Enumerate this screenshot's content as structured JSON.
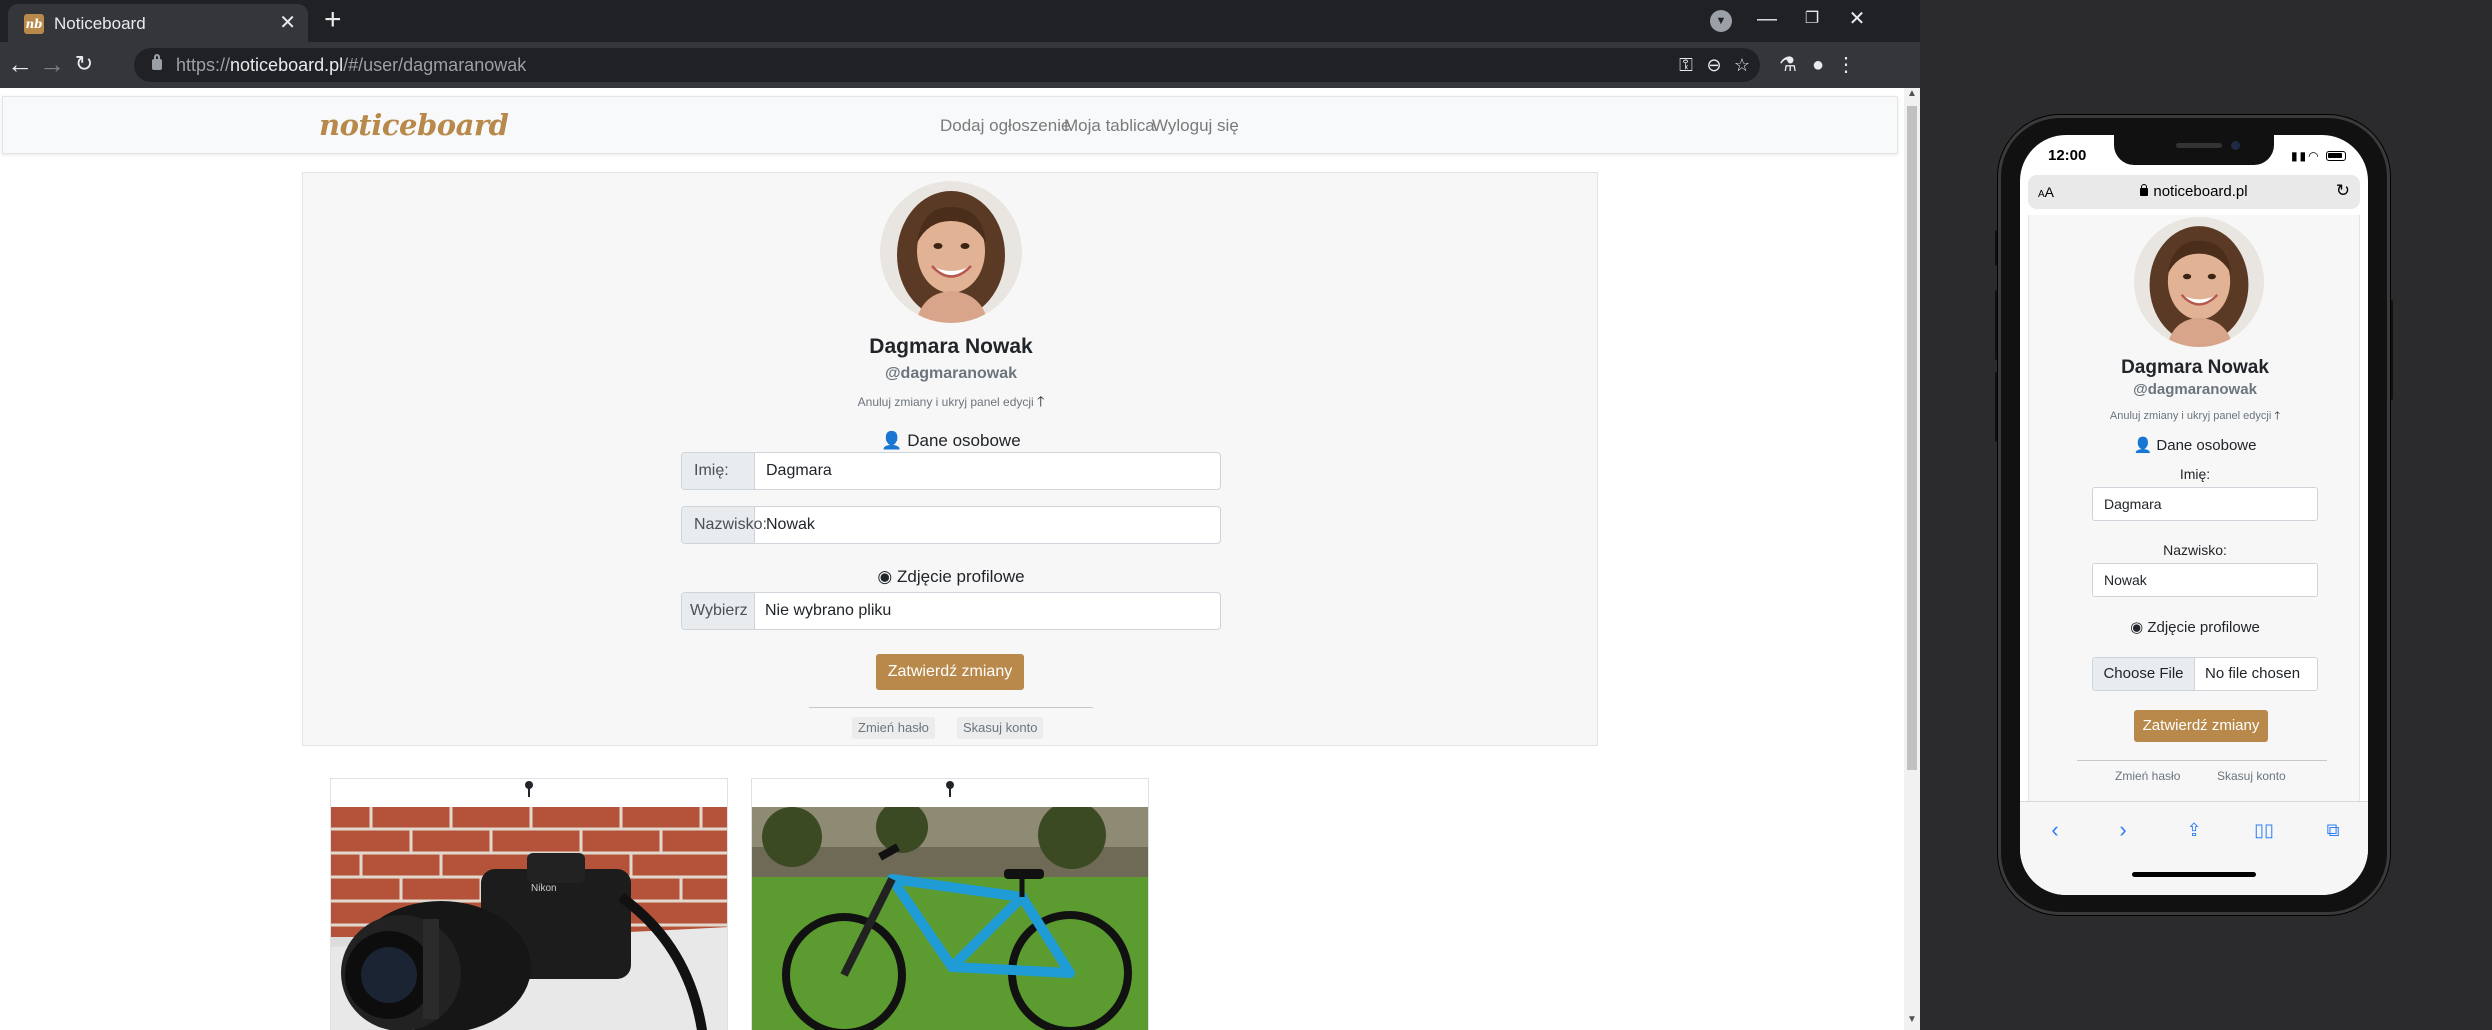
{
  "browser": {
    "tab_title": "Noticeboard",
    "tab_favicon": "nb",
    "url_scheme": "https://",
    "url_host": "noticeboard.pl",
    "url_path": "/#/user/dagmaranowak",
    "icons": [
      "back-icon",
      "forward-icon",
      "reload-icon",
      "key-icon",
      "zoom-icon",
      "star-icon",
      "labs-icon",
      "profile-icon",
      "menu-icon"
    ]
  },
  "site": {
    "brand": "noticeboard",
    "brand_color": "#b8894a",
    "nav": [
      "Dodaj ogłoszenie",
      "Moja tablica",
      "Wyloguj się"
    ]
  },
  "profile": {
    "name": "Dagmara Nowak",
    "username": "@dagmaranowak",
    "cancel_edit": "Anuluj zmiany i ukryj panel edycji",
    "personal_heading": "Dane osobowe",
    "first_name_label": "Imię:",
    "first_name_value": "Dagmara",
    "last_name_label": "Nazwisko:",
    "last_name_value": "Nowak",
    "photo_heading": "Zdjęcie profilowe",
    "file_button": "Wybierz plik",
    "file_status": "Nie wybrano pliku",
    "save_button": "Zatwierdź zmiany",
    "change_password": "Zmień hasło",
    "delete_account": "Skasuj konto"
  },
  "listings": [
    {
      "image": "camera-photo"
    },
    {
      "image": "bicycle-photo"
    }
  ],
  "mobile": {
    "time": "12:00",
    "aa": "AA",
    "host": "noticeboard.pl",
    "name": "Dagmara Nowak",
    "username": "@dagmaranowak",
    "cancel_edit": "Anuluj zmiany i ukryj panel edycji",
    "personal_heading": "Dane osobowe",
    "first_name_label": "Imię:",
    "first_name_value": "Dagmara",
    "last_name_label": "Nazwisko:",
    "last_name_value": "Nowak",
    "photo_heading": "Zdjęcie profilowe",
    "file_button": "Choose File",
    "file_status": "No file chosen",
    "save_button": "Zatwierdź zmiany",
    "change_password": "Zmień hasło",
    "delete_account": "Skasuj konto",
    "accent_color": "#2f7ef6"
  }
}
